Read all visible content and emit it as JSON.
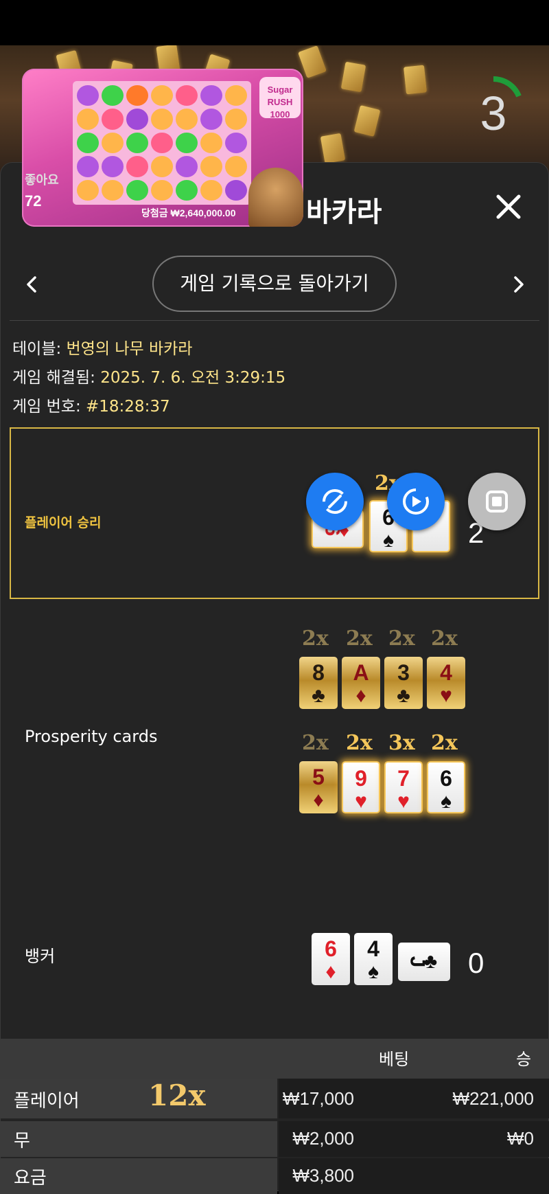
{
  "header": {
    "title": "바카라",
    "countdown": "3"
  },
  "pip": {
    "logo_line1": "Sugar",
    "logo_line2": "RUSH",
    "logo_line3": "1000",
    "win_text": "당첨금 ₩2,640,000.00",
    "like_label": "좋아요",
    "like_count": "72"
  },
  "nav": {
    "back_label": "게임 기록으로 돌아가기"
  },
  "info": {
    "table_label": "테이블:",
    "table_value": "번영의 나무 바카라",
    "resolved_label": "게임 해결됨:",
    "resolved_value": "2025. 7. 6. 오전 3:29:15",
    "number_label": "게임 번호:",
    "number_value": "#18:28:37"
  },
  "player": {
    "result_label": "플레이어 승리",
    "multiplier": "2x",
    "score": "2",
    "cards": [
      {
        "rank": "6",
        "suit": "♦",
        "color": "red"
      },
      {
        "rank": "6",
        "suit": "♠",
        "color": "blk"
      },
      {
        "rank": "",
        "suit": "♥",
        "color": "red"
      }
    ]
  },
  "prosperity": {
    "label": "Prosperity cards",
    "row1": [
      {
        "mult": "2x",
        "rank": "8",
        "suit": "♣",
        "color": "blk"
      },
      {
        "mult": "2x",
        "rank": "A",
        "suit": "♦",
        "color": "red"
      },
      {
        "mult": "2x",
        "rank": "3",
        "suit": "♣",
        "color": "blk"
      },
      {
        "mult": "2x",
        "rank": "4",
        "suit": "♥",
        "color": "red"
      }
    ],
    "row2": [
      {
        "mult": "2x",
        "rank": "5",
        "suit": "♦",
        "color": "red"
      },
      {
        "mult": "2x",
        "rank": "9",
        "suit": "♥",
        "color": "red"
      },
      {
        "mult": "3x",
        "rank": "7",
        "suit": "♥",
        "color": "red"
      },
      {
        "mult": "2x",
        "rank": "6",
        "suit": "♠",
        "color": "blk"
      }
    ]
  },
  "banker": {
    "label": "뱅커",
    "score": "0",
    "cards": [
      {
        "rank": "6",
        "suit": "♦",
        "color": "red"
      },
      {
        "rank": "4",
        "suit": "♠",
        "color": "blk"
      },
      {
        "rank": "J",
        "suit": "♣",
        "color": "blk"
      }
    ]
  },
  "table": {
    "col_bet": "베팅",
    "col_win": "승",
    "rows": [
      {
        "name": "플레이어",
        "multiplier": "12x",
        "bet": "₩17,000",
        "win": "₩221,000"
      },
      {
        "name": "무",
        "multiplier": "",
        "bet": "₩2,000",
        "win": "₩0"
      },
      {
        "name": "요금",
        "multiplier": "",
        "bet": "₩3,800",
        "win": ""
      }
    ]
  },
  "colors": {
    "accent_gold": "#f4c65a",
    "fab_blue": "#1e7cf2",
    "panel_bg": "#242424"
  },
  "icons": [
    "close-icon",
    "chevron-left-icon",
    "chevron-right-icon",
    "rotate-icon",
    "replay-icon",
    "stop-icon"
  ]
}
